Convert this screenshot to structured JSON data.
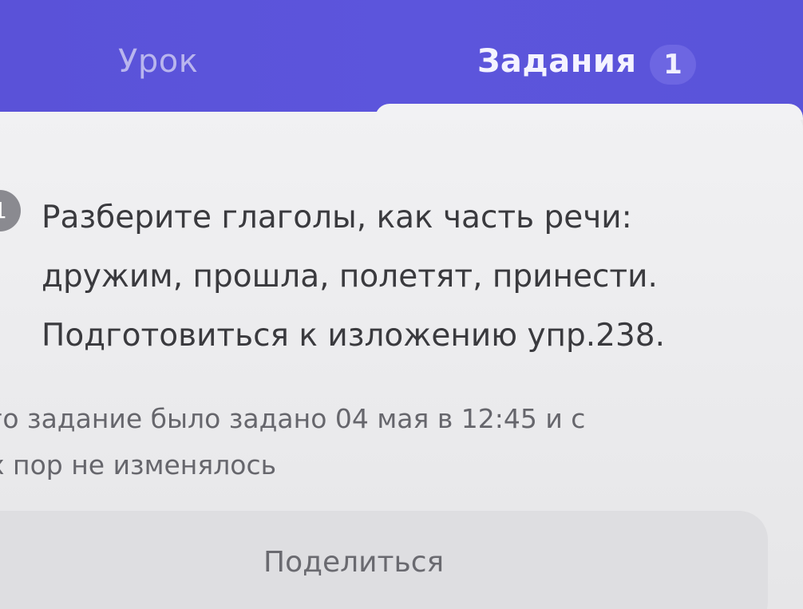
{
  "tabs": {
    "lesson_label": "Урок",
    "tasks_label": "Задания",
    "tasks_badge": "1"
  },
  "task": {
    "number": "1",
    "lines": [
      "Разберите глаголы, как часть речи:",
      "дружим, прошла, полетят, принести.",
      "Подготовиться к изложению упр.238."
    ],
    "meta_lines": [
      "го задание было задано 04 мая в 12:45 и с",
      "х пор не изменялось"
    ]
  },
  "actions": {
    "share_label": "Поделиться"
  },
  "colors": {
    "header_bg": "#5a52d8",
    "tab_inactive": "#b9b5ee",
    "tab_active": "#f4f3ff",
    "card_bg": "#ececee",
    "text_primary": "#3a3a3e",
    "text_secondary": "#66666c",
    "button_bg": "#dedee1"
  }
}
